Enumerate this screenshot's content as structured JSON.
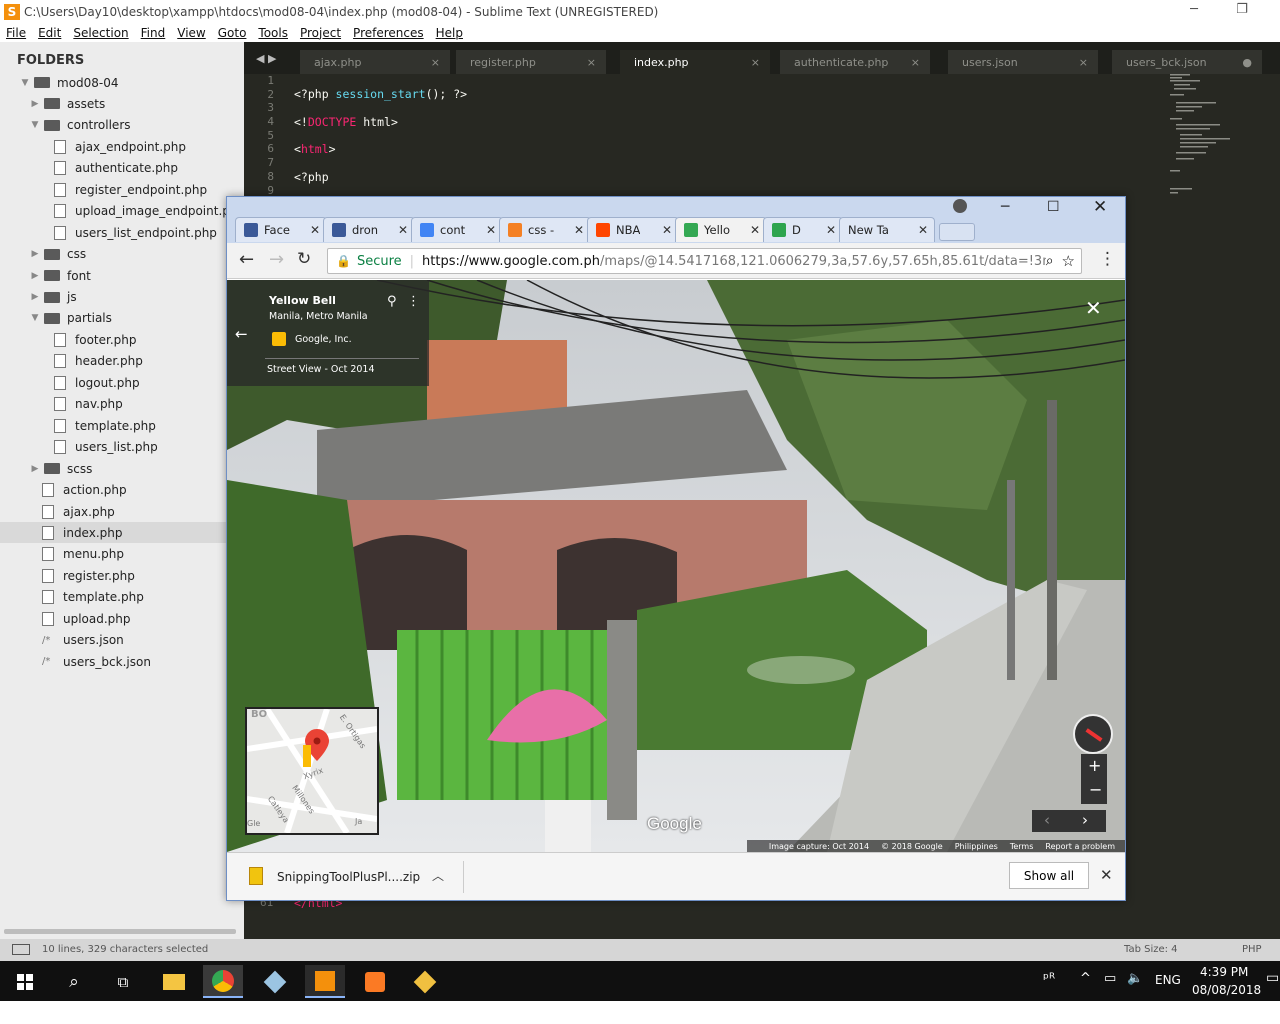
{
  "sublime": {
    "title": "C:\\Users\\Day10\\desktop\\xampp\\htdocs\\mod08-04\\index.php (mod08-04) - Sublime Text (UNREGISTERED)",
    "menu": [
      "File",
      "Edit",
      "Selection",
      "Find",
      "View",
      "Goto",
      "Tools",
      "Project",
      "Preferences",
      "Help"
    ],
    "sidebar_header": "FOLDERS",
    "tree": [
      {
        "label": "mod08-04",
        "type": "folder",
        "depth": 0,
        "open": true
      },
      {
        "label": "assets",
        "type": "folder",
        "depth": 1,
        "open": false
      },
      {
        "label": "controllers",
        "type": "folder",
        "depth": 1,
        "open": true
      },
      {
        "label": "ajax_endpoint.php",
        "type": "file",
        "depth": 2
      },
      {
        "label": "authenticate.php",
        "type": "file",
        "depth": 2
      },
      {
        "label": "register_endpoint.php",
        "type": "file",
        "depth": 2
      },
      {
        "label": "upload_image_endpoint.php",
        "type": "file",
        "depth": 2
      },
      {
        "label": "users_list_endpoint.php",
        "type": "file",
        "depth": 2
      },
      {
        "label": "css",
        "type": "folder",
        "depth": 1,
        "open": false
      },
      {
        "label": "font",
        "type": "folder",
        "depth": 1,
        "open": false
      },
      {
        "label": "js",
        "type": "folder",
        "depth": 1,
        "open": false
      },
      {
        "label": "partials",
        "type": "folder",
        "depth": 1,
        "open": true
      },
      {
        "label": "footer.php",
        "type": "file",
        "depth": 2
      },
      {
        "label": "header.php",
        "type": "file",
        "depth": 2
      },
      {
        "label": "logout.php",
        "type": "file",
        "depth": 2
      },
      {
        "label": "nav.php",
        "type": "file",
        "depth": 2
      },
      {
        "label": "template.php",
        "type": "file",
        "depth": 2
      },
      {
        "label": "users_list.php",
        "type": "file",
        "depth": 2
      },
      {
        "label": "scss",
        "type": "folder",
        "depth": 1,
        "open": false
      },
      {
        "label": "action.php",
        "type": "file",
        "depth": 1
      },
      {
        "label": "ajax.php",
        "type": "file",
        "depth": 1
      },
      {
        "label": "index.php",
        "type": "file",
        "depth": 1,
        "selected": true
      },
      {
        "label": "menu.php",
        "type": "file",
        "depth": 1
      },
      {
        "label": "register.php",
        "type": "file",
        "depth": 1
      },
      {
        "label": "template.php",
        "type": "file",
        "depth": 1
      },
      {
        "label": "upload.php",
        "type": "file",
        "depth": 1
      },
      {
        "label": "users.json",
        "type": "json",
        "depth": 1
      },
      {
        "label": "users_bck.json",
        "type": "json",
        "depth": 1
      }
    ],
    "tabs": [
      {
        "label": "ajax.php",
        "active": false,
        "close": "×"
      },
      {
        "label": "register.php",
        "active": false,
        "close": "×"
      },
      {
        "label": "index.php",
        "active": true,
        "close": "×"
      },
      {
        "label": "authenticate.php",
        "active": false,
        "close": "×"
      },
      {
        "label": "users.json",
        "active": false,
        "close": "×"
      },
      {
        "label": "users_bck.json",
        "active": false,
        "close": "●"
      }
    ],
    "line_numbers": [
      "1",
      "2",
      "3",
      "4",
      "5",
      "6",
      "7",
      "8",
      "9"
    ],
    "last_line_number": "61",
    "last_line_code": "</html>",
    "status_left": "10 lines, 329 characters selected",
    "tab_size": "Tab Size: 4",
    "syntax": "PHP"
  },
  "chrome": {
    "tabs": [
      {
        "label": "Face",
        "icon": "facebook-icon",
        "color": "#3b5998"
      },
      {
        "label": "dron",
        "icon": "facebook-icon",
        "color": "#3b5998"
      },
      {
        "label": "cont",
        "icon": "google-icon",
        "color": "#4285f4"
      },
      {
        "label": "css -",
        "icon": "stackoverflow-icon",
        "color": "#f48024"
      },
      {
        "label": "NBA",
        "icon": "reddit-icon",
        "color": "#ff4500"
      },
      {
        "label": "Yello",
        "icon": "maps-icon",
        "color": "#34a853",
        "active": true
      },
      {
        "label": "D",
        "icon": "check-icon",
        "color": "#2da44e"
      },
      {
        "label": "New Tab",
        "icon": "",
        "color": ""
      }
    ],
    "secure_label": "Secure",
    "url_host": "https://www.google.com.ph",
    "url_path": "/maps/@14.5417168,121.0606279,3a,57.6y,57.65h,85.61t/data=!3m...",
    "place_title": "Yellow Bell",
    "place_sub": "Manila, Metro Manila",
    "place_owner": "Google, Inc.",
    "street_view_date": "Street View - Oct 2014",
    "google_logo": "Google",
    "footer_links": [
      "Image capture: Oct 2014",
      "© 2018 Google",
      "Philippines",
      "Terms",
      "Report a problem"
    ],
    "mini_map_labels": [
      "BO",
      "E. Ortigas",
      "Xyrix",
      "Millones",
      "Catleya",
      "Gle",
      "Ja"
    ],
    "download_file": "SnippingToolPlusPl....zip",
    "show_all": "Show all",
    "street_name": "Yellow Bell"
  },
  "taskbar": {
    "time": "4:39 PM",
    "date": "08/08/2018",
    "lang": "ENG"
  },
  "colors": {
    "editor_bg": "#272822",
    "keyword": "#f92672",
    "function": "#66d9ef",
    "string": "#e6db74",
    "chrome_frame": "#cad8ee"
  }
}
